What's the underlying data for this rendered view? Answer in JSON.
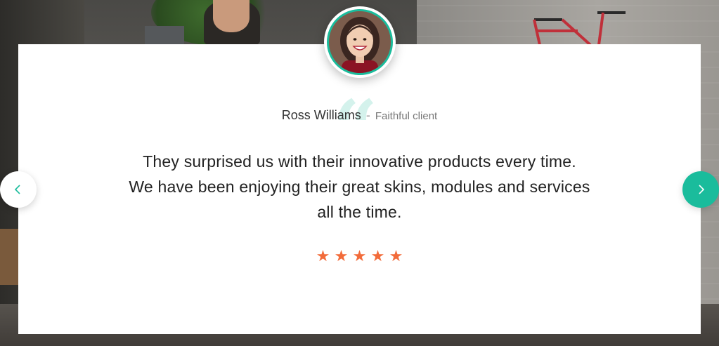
{
  "testimonial": {
    "author_name": "Ross Williams",
    "separator": "-",
    "author_role": "Faithful client",
    "quote_lines": [
      "They surprised us with their innovative products every time.",
      "We have been enjoying their great skins, modules and services",
      "all the time."
    ],
    "rating": 5,
    "rating_max": 5
  },
  "icons": {
    "quote": "quote-icon",
    "star": "star-icon",
    "prev": "chevron-left-icon",
    "next": "chevron-right-icon"
  },
  "colors": {
    "accent": "#1abc9c",
    "star": "#f26b3a",
    "text": "#222222",
    "muted": "#777777"
  }
}
